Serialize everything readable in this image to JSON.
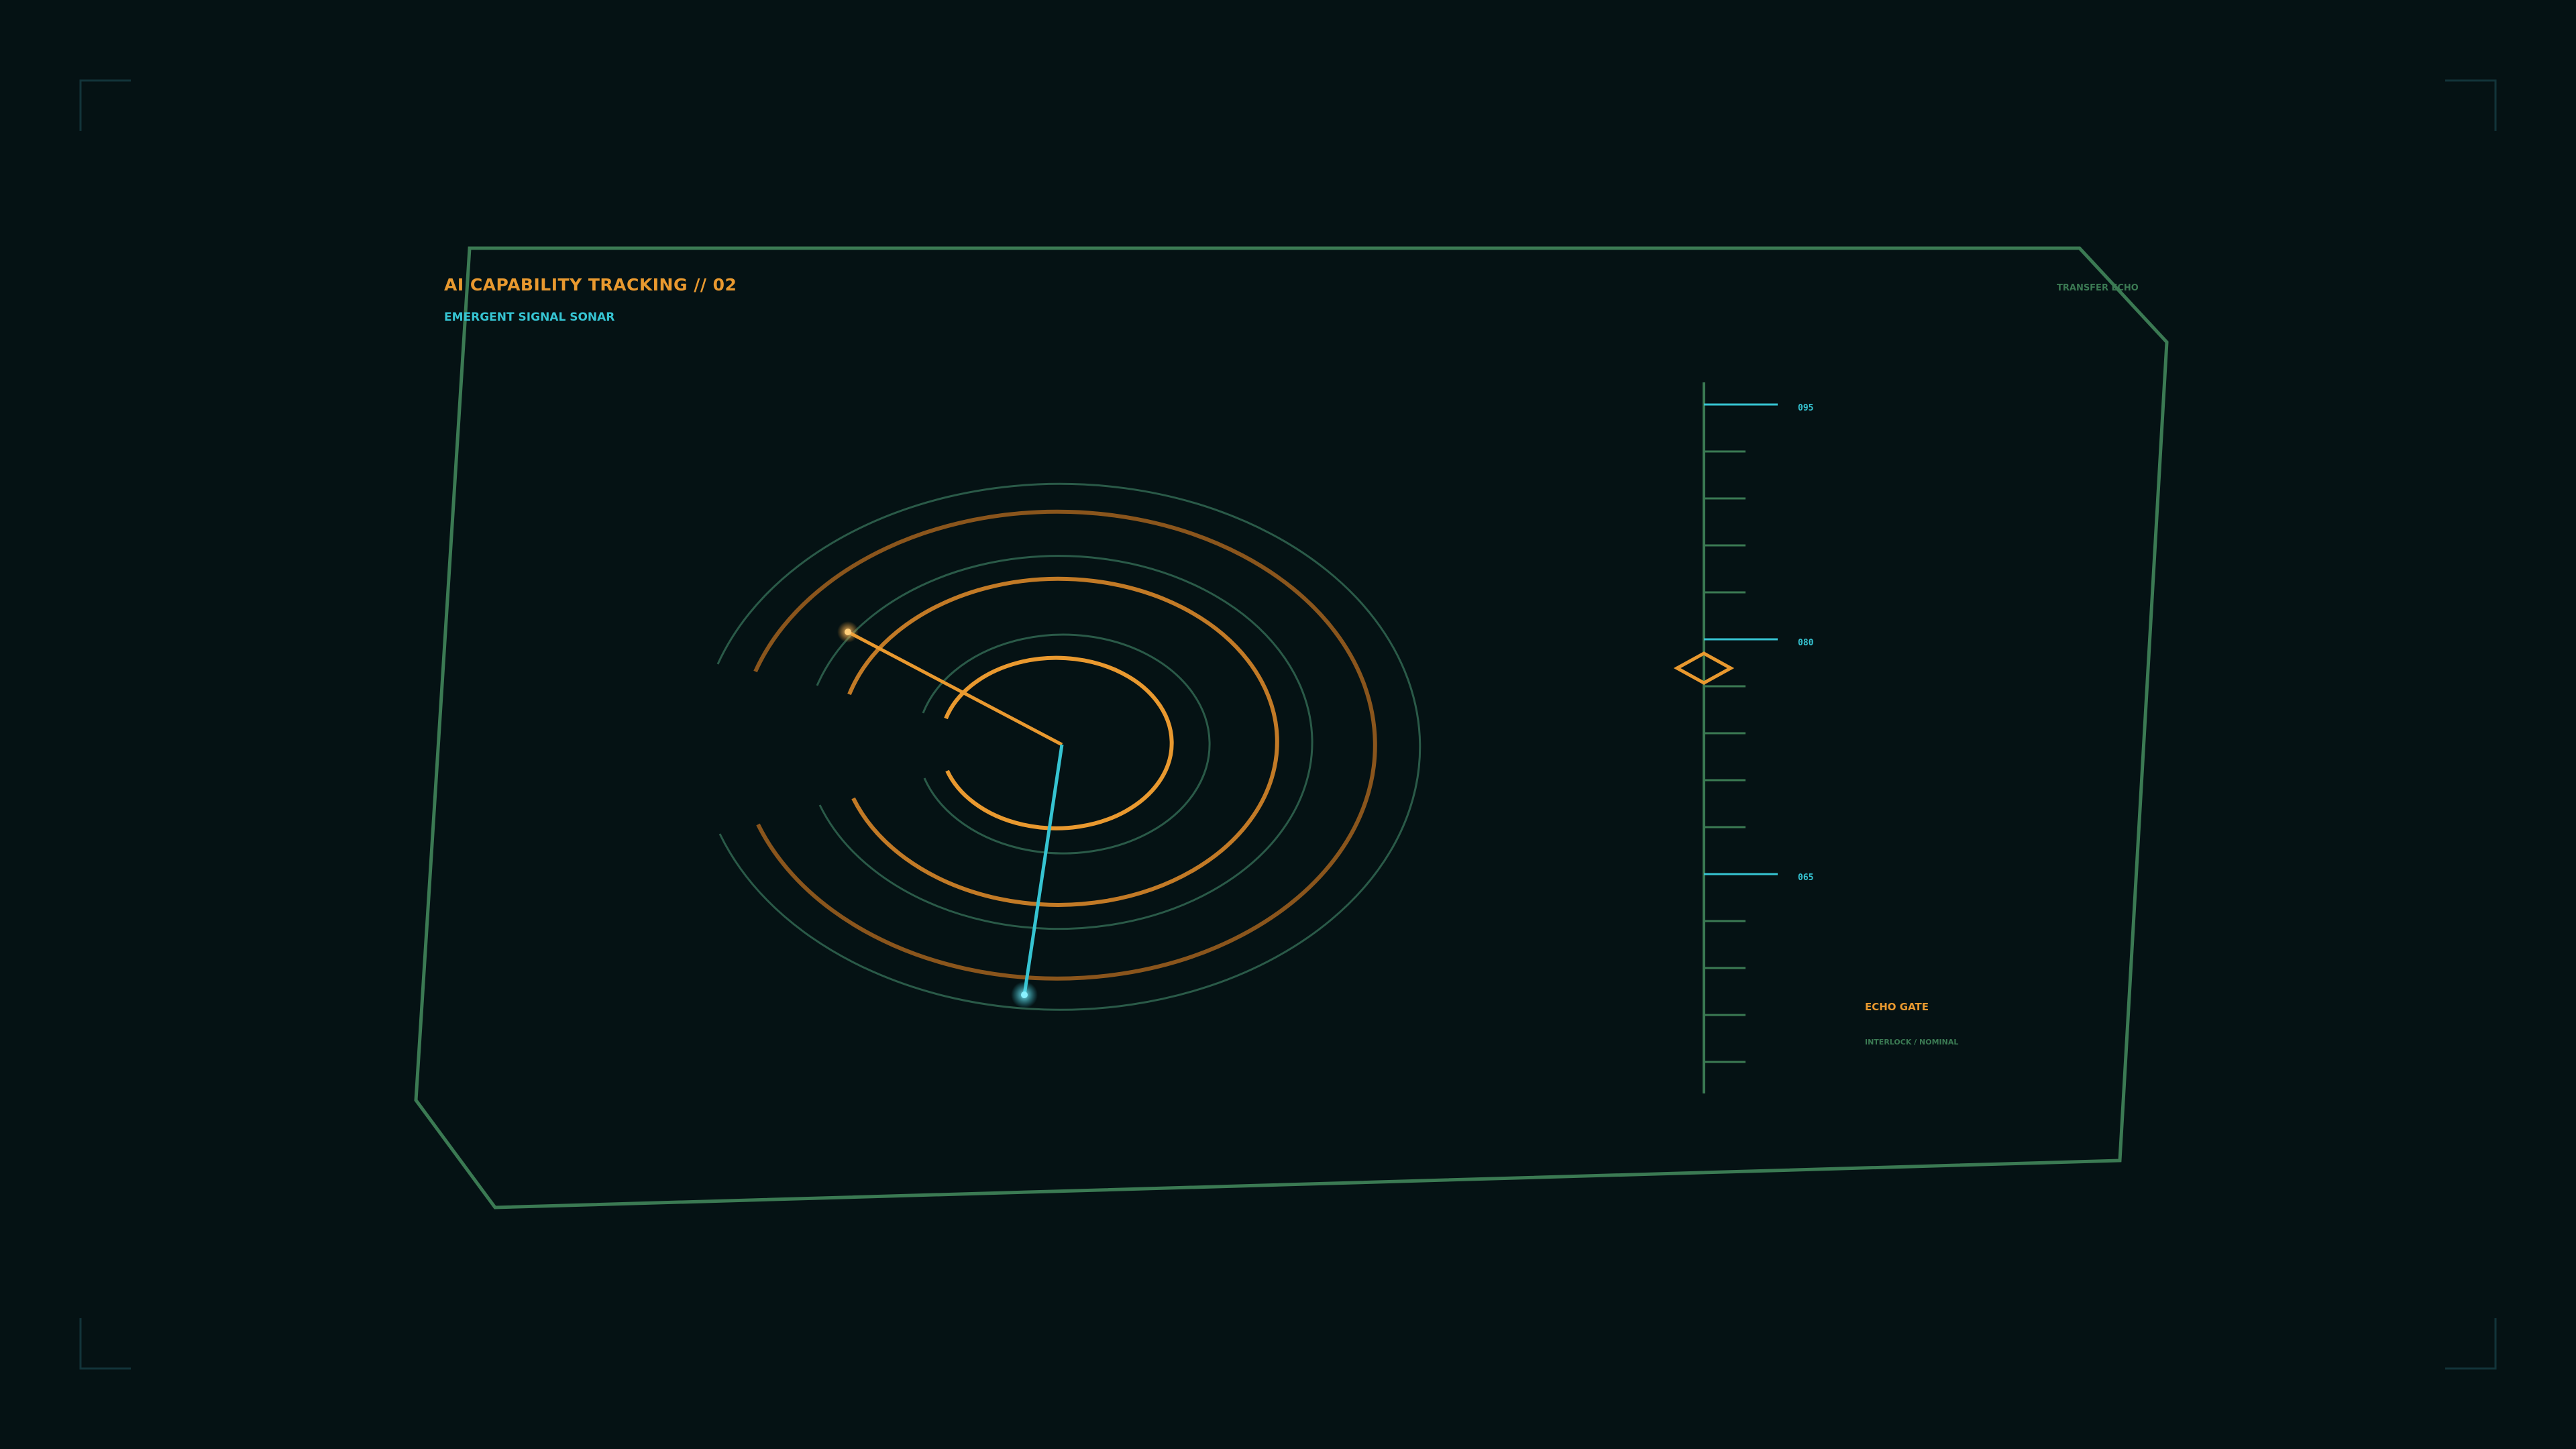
{
  "header": {
    "title": "AI CAPABILITY TRACKING // 02",
    "subtitle": "EMERGENT SIGNAL SONAR",
    "corner_label": "TRANSFER ECHO"
  },
  "gauge": {
    "major_ticks": [
      {
        "label": "095"
      },
      {
        "label": "080"
      },
      {
        "label": "065"
      }
    ],
    "indicator_shape": "diamond"
  },
  "gate": {
    "title": "ECHO GATE",
    "status": "INTERLOCK / NOMINAL"
  },
  "sonar": {
    "sweeps": [
      "amber-sweep",
      "cyan-sweep"
    ]
  },
  "colors": {
    "background": "#051214",
    "frame": "#3b7a53",
    "amber": "#e9992f",
    "amber_dim": "#8a551c",
    "cyan": "#36c4d2",
    "green_dim": "#2a5a48"
  }
}
